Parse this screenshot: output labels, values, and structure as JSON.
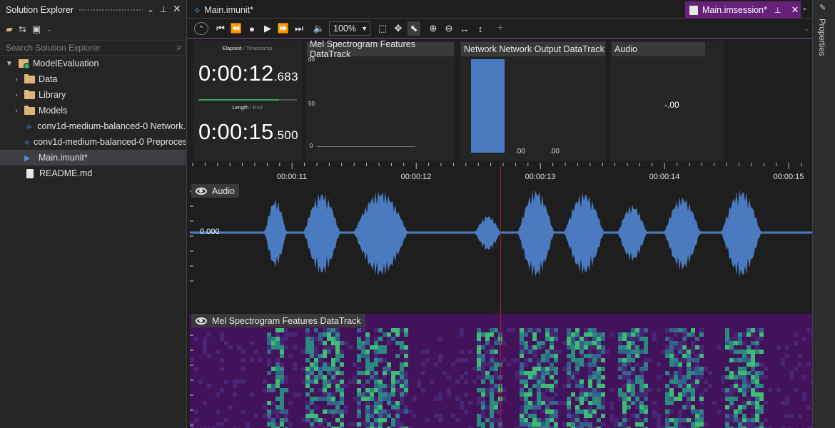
{
  "solution_explorer": {
    "title": "Solution Explorer",
    "search_placeholder": "Search Solution Explorer",
    "items": [
      {
        "label": "ModelEvaluation",
        "icon": "project-icon"
      },
      {
        "label": "Data",
        "icon": "folder-icon"
      },
      {
        "label": "Library",
        "icon": "folder-icon"
      },
      {
        "label": "Models",
        "icon": "folder-icon"
      },
      {
        "label": "conv1d-medium-balanced-0 Network.",
        "icon": "network-icon"
      },
      {
        "label": "conv1d-medium-balanced-0 Preproces",
        "icon": "network-icon"
      },
      {
        "label": "Main.imunit*",
        "icon": "play-file-icon"
      },
      {
        "label": "README.md",
        "icon": "document-icon"
      }
    ]
  },
  "right_panel": {
    "properties_label": "Properties"
  },
  "tabs": {
    "main": "Main.imunit*",
    "session": "Main.imsession*"
  },
  "toolbar": {
    "zoom": "100%"
  },
  "time_panel": {
    "elapsed_label": "Elapsed",
    "timestamp_label": "Timestamp",
    "elapsed_main": "0:00:12",
    "elapsed_frac": ".683",
    "length_label": "Length",
    "end_label": "End",
    "length_main": "0:00:15",
    "length_frac": ".500",
    "progress": 0.82
  },
  "panels": {
    "mel": {
      "title": "Mel Spectrogram Features DataTrack",
      "ticks": [
        "00",
        "50",
        "0"
      ]
    },
    "network": {
      "title": "Network Network Output DataTrack",
      "value_labels": [
        ".00",
        ".00"
      ]
    },
    "audio": {
      "title": "Audio",
      "value": "-.00"
    }
  },
  "timeline": {
    "ticks": [
      "00:00:11",
      "00:00:12",
      "00:00:13",
      "00:00:14",
      "00:00:15"
    ],
    "audio_label": "Audio",
    "audio_zero": "0.000",
    "mel_label": "Mel Spectrogram Features DataTrack"
  },
  "colors": {
    "accent": "#68217a",
    "waveform": "#4a7bc0",
    "playhead": "#a01f2a",
    "spectrogram_bg": "#42125a"
  }
}
